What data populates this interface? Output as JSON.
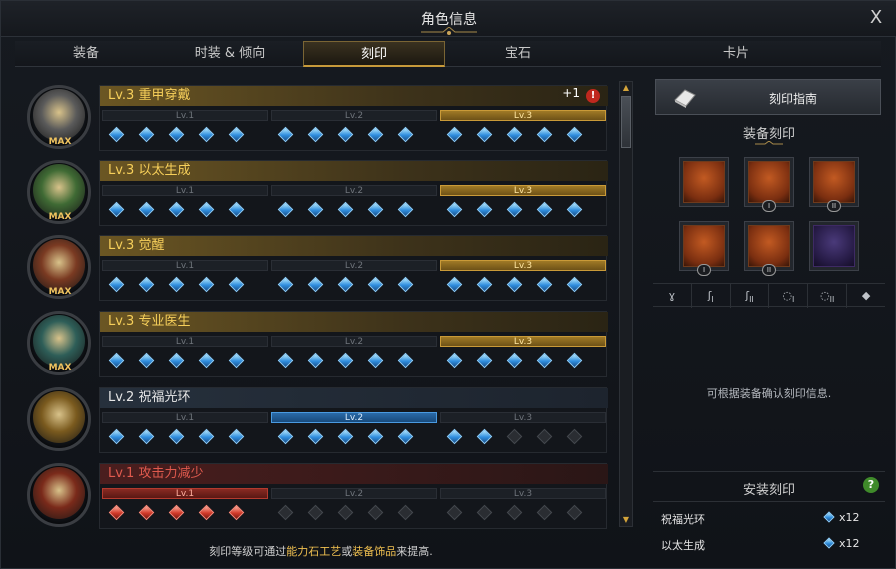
{
  "window": {
    "title": "角色信息",
    "close_label": "X"
  },
  "tabs": [
    {
      "label": "装备",
      "active": false
    },
    {
      "label": "时装 & 倾向",
      "active": false
    },
    {
      "label": "刻印",
      "active": true
    },
    {
      "label": "宝石",
      "active": false
    },
    {
      "label": "卡片",
      "active": false
    }
  ],
  "engravings": [
    {
      "title": "Lv.3 重甲穿戴",
      "style": "gold",
      "max": true,
      "max_label": "MAX",
      "plus": "+1",
      "alert": "!",
      "icon": "heavy-armor-icon",
      "levels": [
        "Lv.1",
        "Lv.2",
        "Lv.3"
      ],
      "active_level": 3,
      "filled": [
        5,
        5,
        5
      ],
      "gem_color": "blue"
    },
    {
      "title": "Lv.3 以太生成",
      "style": "gold",
      "max": true,
      "max_label": "MAX",
      "icon": "ether-generation-icon",
      "levels": [
        "Lv.1",
        "Lv.2",
        "Lv.3"
      ],
      "active_level": 3,
      "filled": [
        5,
        5,
        5
      ],
      "gem_color": "blue"
    },
    {
      "title": "Lv.3 觉醒",
      "style": "gold",
      "max": true,
      "max_label": "MAX",
      "icon": "awakening-icon",
      "levels": [
        "Lv.1",
        "Lv.2",
        "Lv.3"
      ],
      "active_level": 3,
      "filled": [
        5,
        5,
        5
      ],
      "gem_color": "blue"
    },
    {
      "title": "Lv.3 专业医生",
      "style": "gold",
      "max": true,
      "max_label": "MAX",
      "icon": "expert-doctor-icon",
      "levels": [
        "Lv.1",
        "Lv.2",
        "Lv.3"
      ],
      "active_level": 3,
      "filled": [
        5,
        5,
        5
      ],
      "gem_color": "blue"
    },
    {
      "title": "Lv.2 祝福光环",
      "style": "blue",
      "max": false,
      "icon": "blessed-aura-icon",
      "levels": [
        "Lv.1",
        "Lv.2",
        "Lv.3"
      ],
      "active_level": 2,
      "filled": [
        5,
        5,
        2
      ],
      "gem_color": "blue"
    },
    {
      "title": "Lv.1 攻击力减少",
      "style": "red",
      "max": false,
      "icon": "atk-power-reduction-icon",
      "levels": [
        "Lv.1",
        "Lv.2",
        "Lv.3"
      ],
      "active_level": 1,
      "filled": [
        5,
        0,
        0
      ],
      "gem_color": "red"
    }
  ],
  "footer": {
    "prefix": "刻印等级可通过",
    "highlight1": "能力石工艺",
    "mid": "或",
    "highlight2": "装备饰品",
    "suffix": "来提高."
  },
  "side": {
    "guide_label": "刻印指南",
    "equip_title": "装备刻印",
    "equipment": [
      {
        "name": "necklace",
        "icon": "necklace-icon",
        "badge": ""
      },
      {
        "name": "earring-1",
        "icon": "earring-icon",
        "badge": "I"
      },
      {
        "name": "earring-2",
        "icon": "earring-icon",
        "badge": "II"
      },
      {
        "name": "ring-1",
        "icon": "ring-icon",
        "badge": "I"
      },
      {
        "name": "ring-2",
        "icon": "ring-icon",
        "badge": "II"
      },
      {
        "name": "ability-stone",
        "icon": "ability-stone-icon",
        "badge": ""
      }
    ],
    "filters": [
      {
        "name": "necklace",
        "glyph": "ɣ",
        "badge": ""
      },
      {
        "name": "earring-1",
        "glyph": "ʃ",
        "badge": "I"
      },
      {
        "name": "earring-2",
        "glyph": "ʃ",
        "badge": "II"
      },
      {
        "name": "ring-1",
        "glyph": "◌",
        "badge": "I"
      },
      {
        "name": "ring-2",
        "glyph": "◌",
        "badge": "II"
      },
      {
        "name": "ability-stone",
        "glyph": "◆",
        "badge": ""
      }
    ],
    "info_text": "可根据装备确认刻印信息.",
    "install_title": "安装刻印",
    "help_label": "?",
    "installed": [
      {
        "name": "祝福光环",
        "count": "x12"
      },
      {
        "name": "以太生成",
        "count": "x12"
      }
    ]
  },
  "colors": {
    "gold": "#f6cf5a",
    "blue_accent": "#4a9ae0",
    "red_accent": "#e05a4e"
  }
}
